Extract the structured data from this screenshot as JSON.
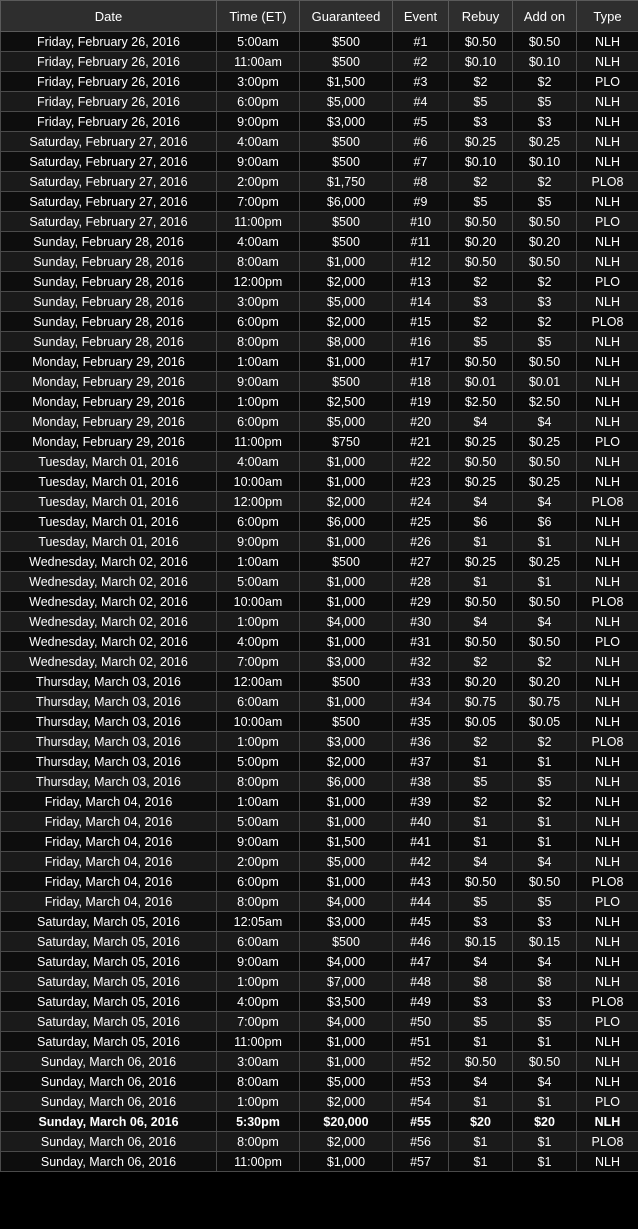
{
  "headers": [
    "Date",
    "Time (ET)",
    "Guaranteed",
    "Event",
    "Rebuy",
    "Add on",
    "Type"
  ],
  "rows": [
    [
      "Friday, February 26, 2016",
      "5:00am",
      "$500",
      "#1",
      "$0.50",
      "$0.50",
      "NLH"
    ],
    [
      "Friday, February 26, 2016",
      "11:00am",
      "$500",
      "#2",
      "$0.10",
      "$0.10",
      "NLH"
    ],
    [
      "Friday, February 26, 2016",
      "3:00pm",
      "$1,500",
      "#3",
      "$2",
      "$2",
      "PLO"
    ],
    [
      "Friday, February 26, 2016",
      "6:00pm",
      "$5,000",
      "#4",
      "$5",
      "$5",
      "NLH"
    ],
    [
      "Friday, February 26, 2016",
      "9:00pm",
      "$3,000",
      "#5",
      "$3",
      "$3",
      "NLH"
    ],
    [
      "Saturday, February 27, 2016",
      "4:00am",
      "$500",
      "#6",
      "$0.25",
      "$0.25",
      "NLH"
    ],
    [
      "Saturday, February 27, 2016",
      "9:00am",
      "$500",
      "#7",
      "$0.10",
      "$0.10",
      "NLH"
    ],
    [
      "Saturday, February 27, 2016",
      "2:00pm",
      "$1,750",
      "#8",
      "$2",
      "$2",
      "PLO8"
    ],
    [
      "Saturday, February 27, 2016",
      "7:00pm",
      "$6,000",
      "#9",
      "$5",
      "$5",
      "NLH"
    ],
    [
      "Saturday, February 27, 2016",
      "11:00pm",
      "$500",
      "#10",
      "$0.50",
      "$0.50",
      "PLO"
    ],
    [
      "Sunday, February 28, 2016",
      "4:00am",
      "$500",
      "#11",
      "$0.20",
      "$0.20",
      "NLH"
    ],
    [
      "Sunday, February 28, 2016",
      "8:00am",
      "$1,000",
      "#12",
      "$0.50",
      "$0.50",
      "NLH"
    ],
    [
      "Sunday, February 28, 2016",
      "12:00pm",
      "$2,000",
      "#13",
      "$2",
      "$2",
      "PLO"
    ],
    [
      "Sunday, February 28, 2016",
      "3:00pm",
      "$5,000",
      "#14",
      "$3",
      "$3",
      "NLH"
    ],
    [
      "Sunday, February 28, 2016",
      "6:00pm",
      "$2,000",
      "#15",
      "$2",
      "$2",
      "PLO8"
    ],
    [
      "Sunday, February 28, 2016",
      "8:00pm",
      "$8,000",
      "#16",
      "$5",
      "$5",
      "NLH"
    ],
    [
      "Monday, February 29, 2016",
      "1:00am",
      "$1,000",
      "#17",
      "$0.50",
      "$0.50",
      "NLH"
    ],
    [
      "Monday, February 29, 2016",
      "9:00am",
      "$500",
      "#18",
      "$0.01",
      "$0.01",
      "NLH"
    ],
    [
      "Monday, February 29, 2016",
      "1:00pm",
      "$2,500",
      "#19",
      "$2.50",
      "$2.50",
      "NLH"
    ],
    [
      "Monday, February 29, 2016",
      "6:00pm",
      "$5,000",
      "#20",
      "$4",
      "$4",
      "NLH"
    ],
    [
      "Monday, February 29, 2016",
      "11:00pm",
      "$750",
      "#21",
      "$0.25",
      "$0.25",
      "PLO"
    ],
    [
      "Tuesday, March 01, 2016",
      "4:00am",
      "$1,000",
      "#22",
      "$0.50",
      "$0.50",
      "NLH"
    ],
    [
      "Tuesday, March 01, 2016",
      "10:00am",
      "$1,000",
      "#23",
      "$0.25",
      "$0.25",
      "NLH"
    ],
    [
      "Tuesday, March 01, 2016",
      "12:00pm",
      "$2,000",
      "#24",
      "$4",
      "$4",
      "PLO8"
    ],
    [
      "Tuesday, March 01, 2016",
      "6:00pm",
      "$6,000",
      "#25",
      "$6",
      "$6",
      "NLH"
    ],
    [
      "Tuesday, March 01, 2016",
      "9:00pm",
      "$1,000",
      "#26",
      "$1",
      "$1",
      "NLH"
    ],
    [
      "Wednesday, March 02, 2016",
      "1:00am",
      "$500",
      "#27",
      "$0.25",
      "$0.25",
      "NLH"
    ],
    [
      "Wednesday, March 02, 2016",
      "5:00am",
      "$1,000",
      "#28",
      "$1",
      "$1",
      "NLH"
    ],
    [
      "Wednesday, March 02, 2016",
      "10:00am",
      "$1,000",
      "#29",
      "$0.50",
      "$0.50",
      "PLO8"
    ],
    [
      "Wednesday, March 02, 2016",
      "1:00pm",
      "$4,000",
      "#30",
      "$4",
      "$4",
      "NLH"
    ],
    [
      "Wednesday, March 02, 2016",
      "4:00pm",
      "$1,000",
      "#31",
      "$0.50",
      "$0.50",
      "PLO"
    ],
    [
      "Wednesday, March 02, 2016",
      "7:00pm",
      "$3,000",
      "#32",
      "$2",
      "$2",
      "NLH"
    ],
    [
      "Thursday, March 03, 2016",
      "12:00am",
      "$500",
      "#33",
      "$0.20",
      "$0.20",
      "NLH"
    ],
    [
      "Thursday, March 03, 2016",
      "6:00am",
      "$1,000",
      "#34",
      "$0.75",
      "$0.75",
      "NLH"
    ],
    [
      "Thursday, March 03, 2016",
      "10:00am",
      "$500",
      "#35",
      "$0.05",
      "$0.05",
      "NLH"
    ],
    [
      "Thursday, March 03, 2016",
      "1:00pm",
      "$3,000",
      "#36",
      "$2",
      "$2",
      "PLO8"
    ],
    [
      "Thursday, March 03, 2016",
      "5:00pm",
      "$2,000",
      "#37",
      "$1",
      "$1",
      "NLH"
    ],
    [
      "Thursday, March 03, 2016",
      "8:00pm",
      "$6,000",
      "#38",
      "$5",
      "$5",
      "NLH"
    ],
    [
      "Friday, March 04, 2016",
      "1:00am",
      "$1,000",
      "#39",
      "$2",
      "$2",
      "NLH"
    ],
    [
      "Friday, March 04, 2016",
      "5:00am",
      "$1,000",
      "#40",
      "$1",
      "$1",
      "NLH"
    ],
    [
      "Friday, March 04, 2016",
      "9:00am",
      "$1,500",
      "#41",
      "$1",
      "$1",
      "NLH"
    ],
    [
      "Friday, March 04, 2016",
      "2:00pm",
      "$5,000",
      "#42",
      "$4",
      "$4",
      "NLH"
    ],
    [
      "Friday, March 04, 2016",
      "6:00pm",
      "$1,000",
      "#43",
      "$0.50",
      "$0.50",
      "PLO8"
    ],
    [
      "Friday, March 04, 2016",
      "8:00pm",
      "$4,000",
      "#44",
      "$5",
      "$5",
      "PLO"
    ],
    [
      "Saturday, March 05, 2016",
      "12:05am",
      "$3,000",
      "#45",
      "$3",
      "$3",
      "NLH"
    ],
    [
      "Saturday, March 05, 2016",
      "6:00am",
      "$500",
      "#46",
      "$0.15",
      "$0.15",
      "NLH"
    ],
    [
      "Saturday, March 05, 2016",
      "9:00am",
      "$4,000",
      "#47",
      "$4",
      "$4",
      "NLH"
    ],
    [
      "Saturday, March 05, 2016",
      "1:00pm",
      "$7,000",
      "#48",
      "$8",
      "$8",
      "NLH"
    ],
    [
      "Saturday, March 05, 2016",
      "4:00pm",
      "$3,500",
      "#49",
      "$3",
      "$3",
      "PLO8"
    ],
    [
      "Saturday, March 05, 2016",
      "7:00pm",
      "$4,000",
      "#50",
      "$5",
      "$5",
      "PLO"
    ],
    [
      "Saturday, March 05, 2016",
      "11:00pm",
      "$1,000",
      "#51",
      "$1",
      "$1",
      "NLH"
    ],
    [
      "Sunday, March 06, 2016",
      "3:00am",
      "$1,000",
      "#52",
      "$0.50",
      "$0.50",
      "NLH"
    ],
    [
      "Sunday, March 06, 2016",
      "8:00am",
      "$5,000",
      "#53",
      "$4",
      "$4",
      "NLH"
    ],
    [
      "Sunday, March 06, 2016",
      "1:00pm",
      "$2,000",
      "#54",
      "$1",
      "$1",
      "PLO"
    ],
    [
      "Sunday, March 06, 2016",
      "5:30pm",
      "$20,000",
      "#55",
      "$20",
      "$20",
      "NLH"
    ],
    [
      "Sunday, March 06, 2016",
      "8:00pm",
      "$2,000",
      "#56",
      "$1",
      "$1",
      "PLO8"
    ],
    [
      "Sunday, March 06, 2016",
      "11:00pm",
      "$1,000",
      "#57",
      "$1",
      "$1",
      "NLH"
    ]
  ],
  "bold_rows": [
    "#55"
  ]
}
